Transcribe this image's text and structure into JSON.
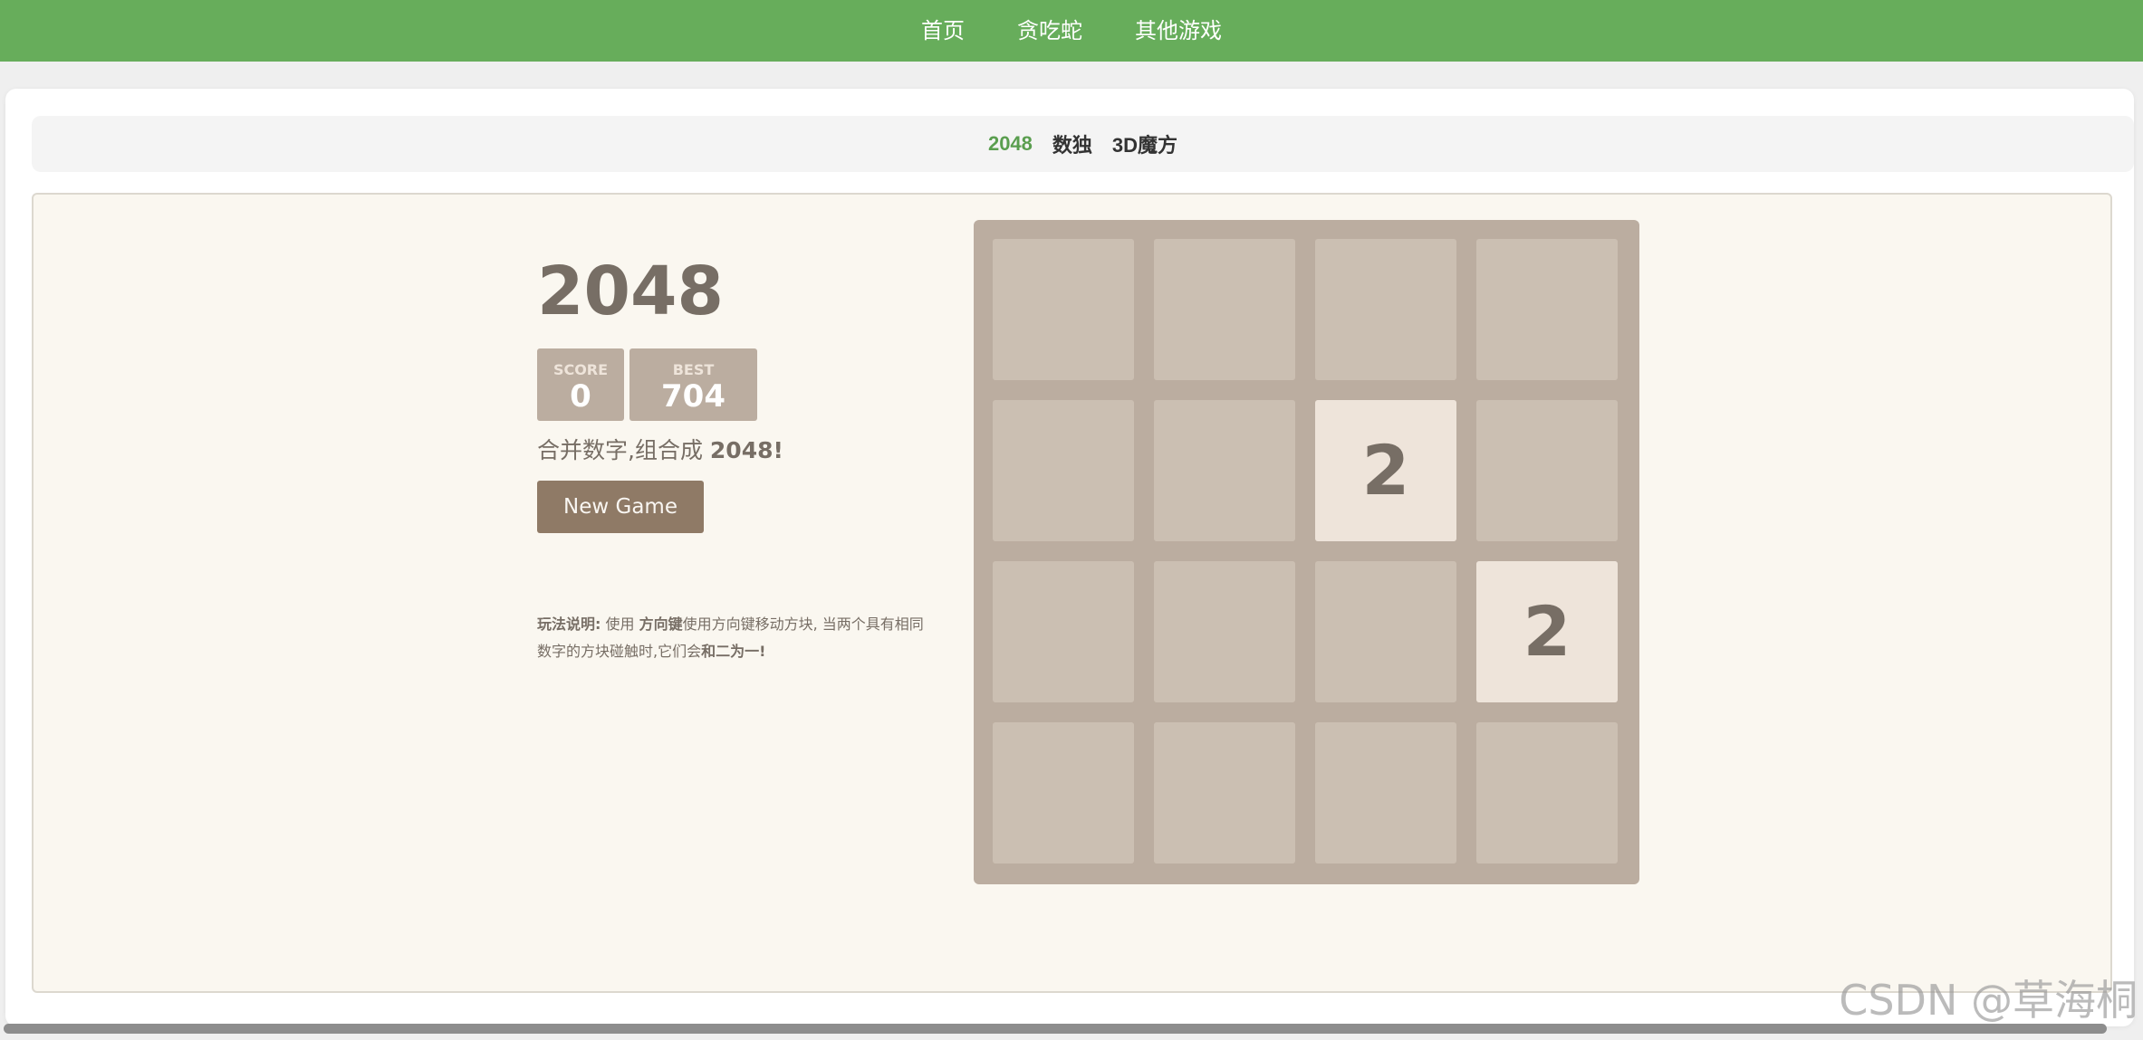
{
  "topnav": {
    "items": [
      {
        "label": "首页"
      },
      {
        "label": "贪吃蛇"
      },
      {
        "label": "其他游戏"
      }
    ],
    "background": "#67ad5b"
  },
  "subnav": {
    "items": [
      {
        "label": "2048",
        "active": true
      },
      {
        "label": "数独",
        "active": false
      },
      {
        "label": "3D魔方",
        "active": false
      }
    ],
    "active_color": "#5a9e4f"
  },
  "game": {
    "title": "2048",
    "score": {
      "label": "SCORE",
      "value": "0"
    },
    "best": {
      "label": "BEST",
      "value": "704"
    },
    "intro_prefix": "合并数字,组合成 ",
    "intro_target": "2048!",
    "new_game_label": "New Game",
    "howto": {
      "heading": "玩法说明:",
      "text1": " 使用 ",
      "keys": "方向键",
      "text2": "使用方向键移动方块, 当两个具有相同数字的方块碰触时,它们会",
      "merge": "和二为一!"
    },
    "board": {
      "size": 4,
      "rows": [
        [
          null,
          null,
          null,
          null
        ],
        [
          null,
          null,
          2,
          null
        ],
        [
          null,
          null,
          null,
          2
        ],
        [
          null,
          null,
          null,
          null
        ]
      ]
    },
    "colors": {
      "board_bg": "#bbada0",
      "empty_cell": "#cdc1b4",
      "tile_2_bg": "#eee4da",
      "tile_text": "#776e65",
      "button_bg": "#8f7a66",
      "panel_bg": "#faf7f0"
    }
  },
  "watermark": "CSDN @草海桐"
}
